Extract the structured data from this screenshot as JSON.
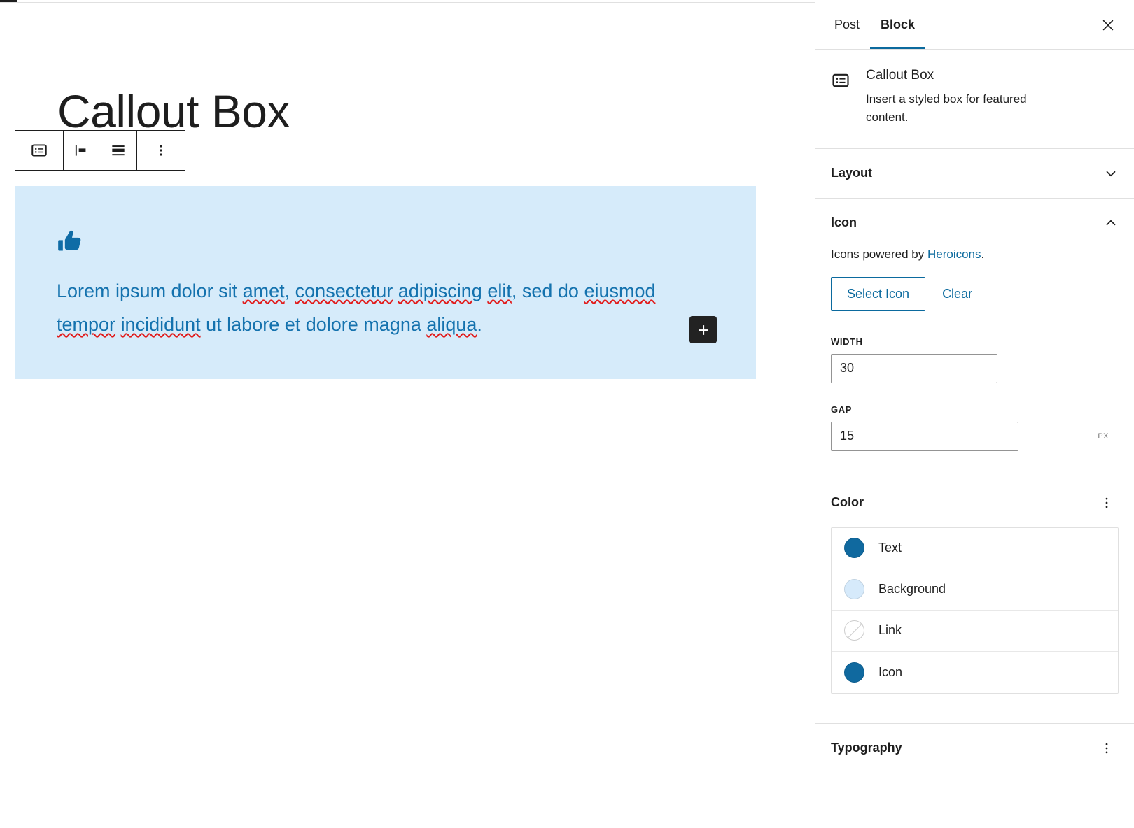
{
  "editor": {
    "post_title": "Callout Box",
    "toolbar": {
      "block_type_label": "Callout Box",
      "align_left_label": "Align left",
      "align_wide_label": "Wide width",
      "more_options_label": "Options"
    },
    "callout": {
      "icon_name": "thumb-up-icon",
      "body_segments": [
        {
          "text": "Lorem ipsum dolor sit ",
          "spellcheck": false
        },
        {
          "text": "amet",
          "spellcheck": true
        },
        {
          "text": ", ",
          "spellcheck": false
        },
        {
          "text": "consectetur",
          "spellcheck": true
        },
        {
          "text": " ",
          "spellcheck": false
        },
        {
          "text": "adipiscing",
          "spellcheck": true
        },
        {
          "text": " ",
          "spellcheck": false
        },
        {
          "text": "elit",
          "spellcheck": true
        },
        {
          "text": ", sed do ",
          "spellcheck": false
        },
        {
          "text": "eiusmod",
          "spellcheck": true
        },
        {
          "text": " ",
          "spellcheck": false
        },
        {
          "text": "tempor",
          "spellcheck": true
        },
        {
          "text": " ",
          "spellcheck": false
        },
        {
          "text": "incididunt",
          "spellcheck": true
        },
        {
          "text": " ut labore et dolore magna ",
          "spellcheck": false
        },
        {
          "text": "aliqua",
          "spellcheck": true
        },
        {
          "text": ".",
          "spellcheck": false
        }
      ],
      "background_color": "#d6ebfa",
      "text_color": "#1472ae",
      "icon_color": "#0f6ca6"
    },
    "add_block_label": "+"
  },
  "sidebar": {
    "tabs": [
      {
        "label": "Post",
        "active": false
      },
      {
        "label": "Block",
        "active": true
      }
    ],
    "close_label": "Close settings",
    "block_card": {
      "icon_name": "callout-block-icon",
      "title": "Callout Box",
      "description": "Insert a styled box for featured content."
    },
    "panels": {
      "layout": {
        "title": "Layout",
        "expanded": false
      },
      "icon": {
        "title": "Icon",
        "expanded": true,
        "credit_prefix": "Icons powered by ",
        "credit_link": "Heroicons",
        "credit_suffix": ".",
        "select_icon_label": "Select Icon",
        "clear_label": "Clear",
        "width": {
          "label": "Width",
          "value": "30"
        },
        "gap": {
          "label": "Gap",
          "value": "15",
          "unit": "px"
        }
      },
      "color": {
        "title": "Color",
        "options_label": "Color options",
        "rows": [
          {
            "label": "Text",
            "swatch": "#10699f",
            "empty": false
          },
          {
            "label": "Background",
            "swatch": "#d6eafb",
            "empty": false
          },
          {
            "label": "Link",
            "swatch": "",
            "empty": true
          },
          {
            "label": "Icon",
            "swatch": "#10699f",
            "empty": false
          }
        ]
      },
      "typography": {
        "title": "Typography",
        "options_label": "Typography options"
      }
    }
  },
  "theme": {
    "accent": "#0b6a9e",
    "border": "#e0e0e0",
    "text": "#1e1e1e"
  }
}
